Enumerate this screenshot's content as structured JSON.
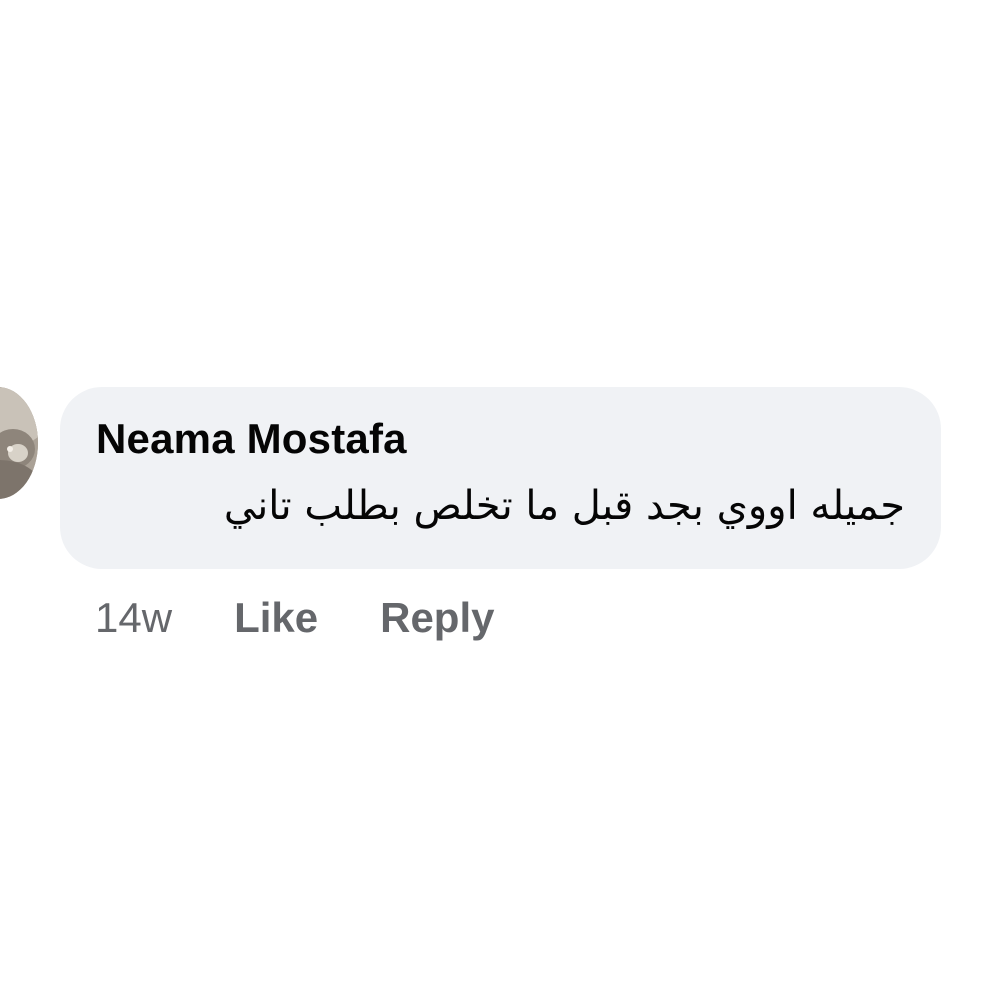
{
  "comment": {
    "author": "Neama Mostafa",
    "text": "جميله اووي بجد قبل ما تخلص بطلب تاني",
    "timestamp": "14w",
    "actions": {
      "like_label": "Like",
      "reply_label": "Reply"
    }
  },
  "colors": {
    "bubble_background": "#f0f2f5",
    "primary_text": "#050505",
    "secondary_text": "#65676b"
  }
}
